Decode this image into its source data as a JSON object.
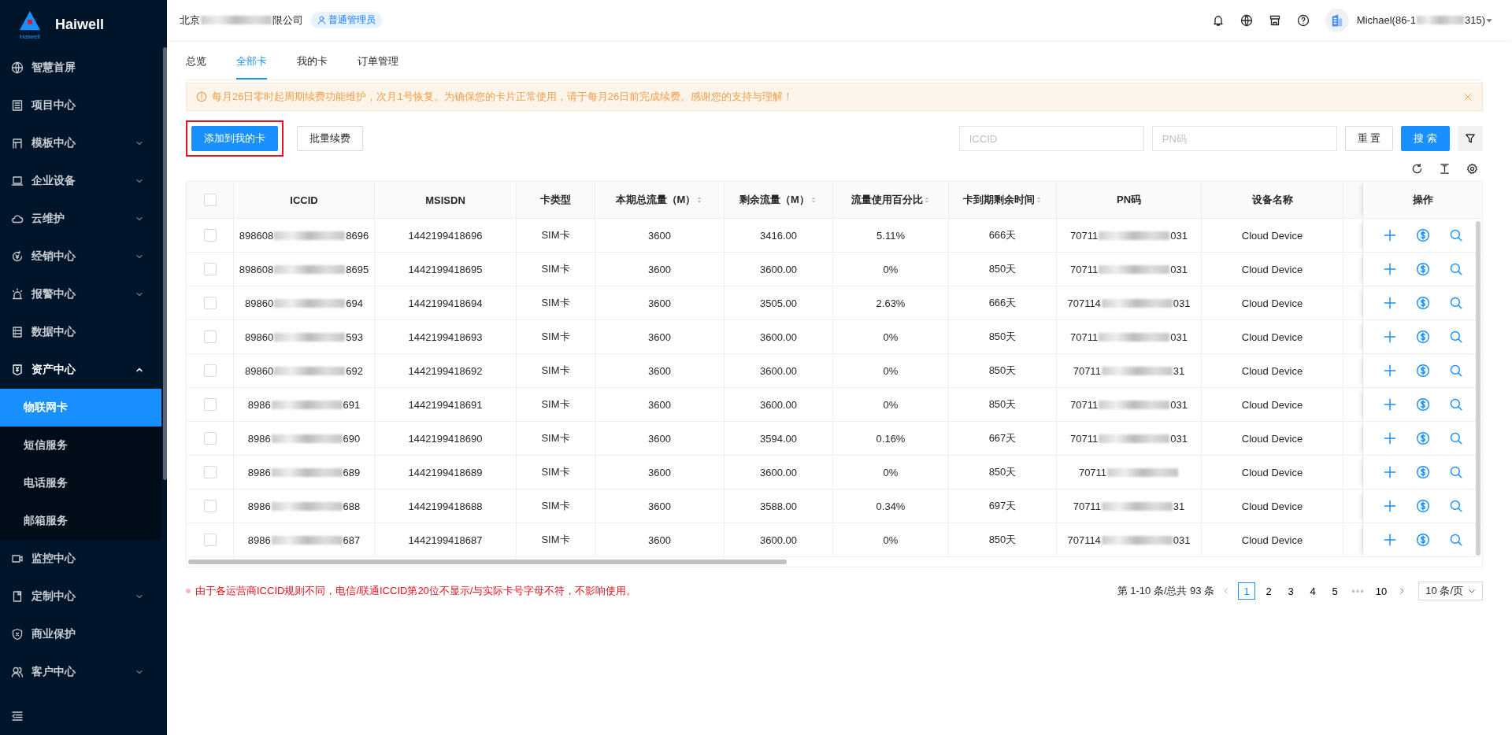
{
  "sidebar": {
    "logo": {
      "name": "Haiwell",
      "caption": "Haiwell"
    },
    "items": [
      {
        "label": "智慧首屏",
        "has_children": false,
        "expanded": false
      },
      {
        "label": "项目中心",
        "has_children": false,
        "expanded": false
      },
      {
        "label": "模板中心",
        "has_children": true,
        "expanded": false
      },
      {
        "label": "企业设备",
        "has_children": true,
        "expanded": false
      },
      {
        "label": "云维护",
        "has_children": true,
        "expanded": false
      },
      {
        "label": "经销中心",
        "has_children": true,
        "expanded": false
      },
      {
        "label": "报警中心",
        "has_children": true,
        "expanded": false
      },
      {
        "label": "数据中心",
        "has_children": false,
        "expanded": false
      },
      {
        "label": "资产中心",
        "has_children": true,
        "expanded": true,
        "children": [
          {
            "label": "物联网卡",
            "selected": true
          },
          {
            "label": "短信服务",
            "selected": false
          },
          {
            "label": "电话服务",
            "selected": false
          },
          {
            "label": "邮箱服务",
            "selected": false
          }
        ]
      },
      {
        "label": "监控中心",
        "has_children": false,
        "expanded": false
      },
      {
        "label": "定制中心",
        "has_children": true,
        "expanded": false
      },
      {
        "label": "商业保护",
        "has_children": false,
        "expanded": false
      },
      {
        "label": "客户中心",
        "has_children": true,
        "expanded": false
      }
    ]
  },
  "header": {
    "company_prefix": "北京",
    "company_suffix": "限公司",
    "role_badge": "普通管理员",
    "user_prefix": "Michael(86-1",
    "user_suffix": "315)"
  },
  "tabs": [
    {
      "label": "总览",
      "selected": false
    },
    {
      "label": "全部卡",
      "selected": true
    },
    {
      "label": "我的卡",
      "selected": false
    },
    {
      "label": "订单管理",
      "selected": false
    }
  ],
  "notice": {
    "text": "每月26日零时起周期续费功能维护，次月1号恢复。为确保您的卡片正常使用，请于每月26日前完成续费。感谢您的支持与理解！"
  },
  "actions": [
    {
      "label": "添加到我的卡",
      "primary": true,
      "highlighted": true
    },
    {
      "label": "批量续费",
      "primary": false,
      "highlighted": false
    }
  ],
  "search": {
    "fields": [
      {
        "placeholder": "ICCID"
      },
      {
        "placeholder": "PN码"
      }
    ],
    "reset": "重 置",
    "submit": "搜 索"
  },
  "table": {
    "header_checked": false,
    "columns": [
      {
        "label": "ICCID",
        "sortable": false
      },
      {
        "label": "MSISDN",
        "sortable": false
      },
      {
        "label": "卡类型",
        "sortable": false
      },
      {
        "label": "本期总流量（M）",
        "sortable": true
      },
      {
        "label": "剩余流量（M）",
        "sortable": true
      },
      {
        "label": "流量使用百分比",
        "sortable": true
      },
      {
        "label": "卡到期剩余时间",
        "sortable": true
      },
      {
        "label": "PN码",
        "sortable": false
      },
      {
        "label": "设备名称",
        "sortable": false
      },
      {
        "label": "操作",
        "sortable": false
      }
    ],
    "rows": [
      {
        "selected": false,
        "iccid_prefix": "898608",
        "iccid_suffix": "8696",
        "msisdn": "1442199418696",
        "type": "SIM卡",
        "total": "3600",
        "remaining": "3416.00",
        "usage": "5.11%",
        "days": "666天",
        "pn_prefix": "70711",
        "pn_suffix": "031",
        "device": "Cloud Device"
      },
      {
        "selected": false,
        "iccid_prefix": "898608",
        "iccid_suffix": "8695",
        "msisdn": "1442199418695",
        "type": "SIM卡",
        "total": "3600",
        "remaining": "3600.00",
        "usage": "0%",
        "days": "850天",
        "pn_prefix": "70711",
        "pn_suffix": "031",
        "device": "Cloud Device"
      },
      {
        "selected": false,
        "iccid_prefix": "89860",
        "iccid_suffix": "694",
        "msisdn": "1442199418694",
        "type": "SIM卡",
        "total": "3600",
        "remaining": "3505.00",
        "usage": "2.63%",
        "days": "666天",
        "pn_prefix": "707114",
        "pn_suffix": "031",
        "device": "Cloud Device"
      },
      {
        "selected": false,
        "iccid_prefix": "89860",
        "iccid_suffix": "593",
        "msisdn": "1442199418693",
        "type": "SIM卡",
        "total": "3600",
        "remaining": "3600.00",
        "usage": "0%",
        "days": "850天",
        "pn_prefix": "70711",
        "pn_suffix": "031",
        "device": "Cloud Device"
      },
      {
        "selected": false,
        "iccid_prefix": "89860",
        "iccid_suffix": "692",
        "msisdn": "1442199418692",
        "type": "SIM卡",
        "total": "3600",
        "remaining": "3600.00",
        "usage": "0%",
        "days": "850天",
        "pn_prefix": "70711",
        "pn_suffix": "31",
        "device": "Cloud Device"
      },
      {
        "selected": false,
        "iccid_prefix": "8986",
        "iccid_suffix": "691",
        "msisdn": "1442199418691",
        "type": "SIM卡",
        "total": "3600",
        "remaining": "3600.00",
        "usage": "0%",
        "days": "850天",
        "pn_prefix": "70711",
        "pn_suffix": "031",
        "device": "Cloud Device"
      },
      {
        "selected": false,
        "iccid_prefix": "8986",
        "iccid_suffix": "690",
        "msisdn": "1442199418690",
        "type": "SIM卡",
        "total": "3600",
        "remaining": "3594.00",
        "usage": "0.16%",
        "days": "667天",
        "pn_prefix": "70711",
        "pn_suffix": "031",
        "device": "Cloud Device"
      },
      {
        "selected": false,
        "iccid_prefix": "8986",
        "iccid_suffix": "689",
        "msisdn": "1442199418689",
        "type": "SIM卡",
        "total": "3600",
        "remaining": "3600.00",
        "usage": "0%",
        "days": "850天",
        "pn_prefix": "70711",
        "pn_suffix": "",
        "device": "Cloud Device"
      },
      {
        "selected": false,
        "iccid_prefix": "8986",
        "iccid_suffix": "688",
        "msisdn": "1442199418688",
        "type": "SIM卡",
        "total": "3600",
        "remaining": "3588.00",
        "usage": "0.34%",
        "days": "697天",
        "pn_prefix": "70711",
        "pn_suffix": "31",
        "device": "Cloud Device"
      },
      {
        "selected": false,
        "iccid_prefix": "8986",
        "iccid_suffix": "687",
        "msisdn": "1442199418687",
        "type": "SIM卡",
        "total": "3600",
        "remaining": "3600.00",
        "usage": "0%",
        "days": "850天",
        "pn_prefix": "707114",
        "pn_suffix": "031",
        "device": "Cloud Device"
      }
    ]
  },
  "footer_note": "由于各运营商ICCID规则不同，电信/联通ICCID第20位不显示/与实际卡号字母不符，不影响使用。",
  "pagination": {
    "summary": "第 1-10 条/总共 93 条",
    "pages": [
      {
        "label": "1",
        "selected": true
      },
      {
        "label": "2",
        "selected": false
      },
      {
        "label": "3",
        "selected": false
      },
      {
        "label": "4",
        "selected": false
      },
      {
        "label": "5",
        "selected": false
      },
      {
        "label": "•••",
        "selected": false
      },
      {
        "label": "10",
        "selected": false
      }
    ],
    "page_size": "10 条/页"
  }
}
